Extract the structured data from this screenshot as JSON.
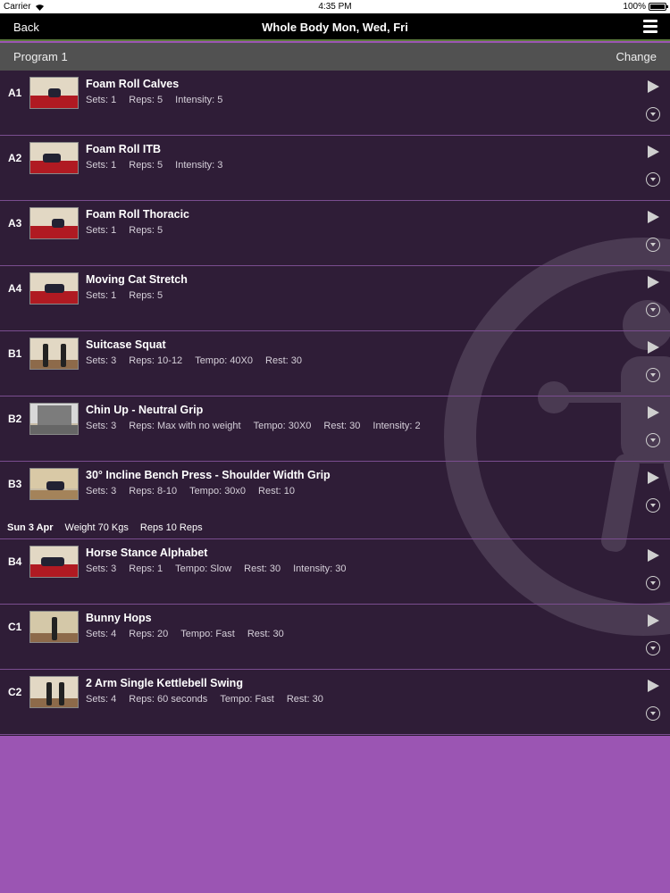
{
  "status_bar": {
    "carrier": "Carrier",
    "time": "4:35 PM",
    "battery": "100%"
  },
  "nav": {
    "back": "Back",
    "title": "Whole Body Mon, Wed, Fri",
    "menu_icon": "hamburger-menu-icon"
  },
  "program": {
    "label": "Program 1",
    "change": "Change"
  },
  "colors": {
    "list_bg": "#2f1d37",
    "divider": "#7a4d8f",
    "page_bg": "#9b55b3"
  },
  "exercises": [
    {
      "code": "A1",
      "name": "Foam Roll Calves",
      "meta": [
        "Sets: 1",
        "Reps: 5",
        "Intensity: 5"
      ]
    },
    {
      "code": "A2",
      "name": "Foam Roll ITB",
      "meta": [
        "Sets: 1",
        "Reps: 5",
        "Intensity: 3"
      ]
    },
    {
      "code": "A3",
      "name": "Foam Roll Thoracic",
      "meta": [
        "Sets: 1",
        "Reps: 5"
      ]
    },
    {
      "code": "A4",
      "name": "Moving Cat Stretch",
      "meta": [
        "Sets: 1",
        "Reps: 5"
      ]
    },
    {
      "code": "B1",
      "name": "Suitcase Squat",
      "meta": [
        "Sets: 3",
        "Reps: 10-12",
        "Tempo: 40X0",
        "Rest: 30"
      ]
    },
    {
      "code": "B2",
      "name": "Chin Up - Neutral Grip",
      "meta": [
        "Sets: 3",
        "Reps: Max with no weight",
        "Tempo: 30X0",
        "Rest: 30",
        "Intensity: 2"
      ]
    },
    {
      "code": "B3",
      "name": "30° Incline Bench Press - Shoulder Width Grip",
      "meta": [
        "Sets: 3",
        "Reps: 8-10",
        "Tempo: 30x0",
        "Rest: 10"
      ],
      "history": {
        "date": "Sun 3 Apr",
        "weight": "Weight 70 Kgs",
        "reps": "Reps 10 Reps"
      }
    },
    {
      "code": "B4",
      "name": "Horse Stance Alphabet",
      "meta": [
        "Sets: 3",
        "Reps: 1",
        "Tempo: Slow",
        "Rest: 30",
        "Intensity: 30"
      ]
    },
    {
      "code": "C1",
      "name": "Bunny Hops",
      "meta": [
        "Sets: 4",
        "Reps: 20",
        "Tempo: Fast",
        "Rest: 30"
      ]
    },
    {
      "code": "C2",
      "name": "2 Arm Single Kettlebell Swing",
      "meta": [
        "Sets: 4",
        "Reps: 60 seconds",
        "Tempo: Fast",
        "Rest: 30"
      ]
    }
  ]
}
